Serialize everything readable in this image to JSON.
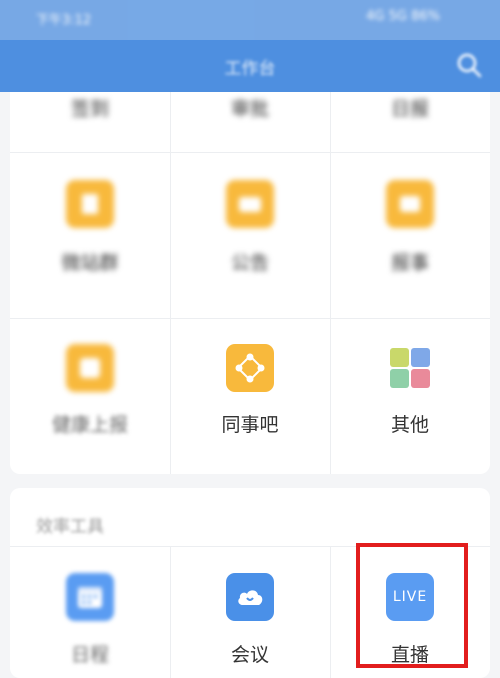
{
  "status_bar": {
    "time": "下午3:12",
    "indicators": "4G 5G 86%"
  },
  "header": {
    "title": "工作台"
  },
  "top_row": [
    "签到",
    "审批",
    "日报"
  ],
  "apps": [
    {
      "label": "微站群",
      "icon": "doc-icon",
      "color": "#f8b93c"
    },
    {
      "label": "公告",
      "icon": "message-icon",
      "color": "#f8b93c"
    },
    {
      "label": "报事",
      "icon": "bag-icon",
      "color": "#f8b93c"
    },
    {
      "label": "健康上报",
      "icon": "health-icon",
      "color": "#f8b93c"
    },
    {
      "label": "同事吧",
      "icon": "colleague-icon",
      "color": "#f8b93c"
    },
    {
      "label": "其他",
      "icon": "grid-icon",
      "color": "#8bc34a"
    }
  ],
  "efficiency": {
    "title": "效率工具",
    "items": [
      {
        "label": "日程",
        "icon": "calendar-icon",
        "color": "#5a9cf2"
      },
      {
        "label": "会议",
        "icon": "meeting-icon",
        "color": "#4a90e8"
      },
      {
        "label": "直播",
        "icon": "live-icon",
        "icon_text": "LIVE",
        "color": "#5a9cf2"
      }
    ]
  }
}
